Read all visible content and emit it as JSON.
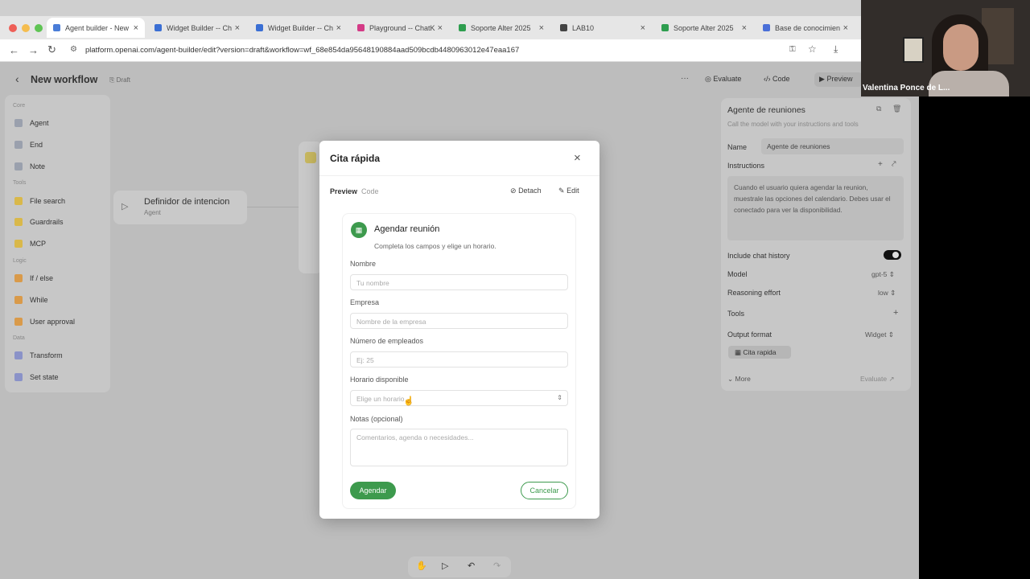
{
  "browser": {
    "tabs": [
      {
        "label": "Agent builder - New",
        "color": "#4a7dd8"
      },
      {
        "label": "Widget Builder -- Ch",
        "color": "#3b6fd4"
      },
      {
        "label": "Widget Builder -- Ch",
        "color": "#3b6fd4"
      },
      {
        "label": "Playground -- ChatK",
        "color": "#d43b86"
      },
      {
        "label": "Soporte Alter 2025",
        "color": "#2e9e4f"
      },
      {
        "label": "LAB10",
        "color": "#444444"
      },
      {
        "label": "Soporte Alter 2025",
        "color": "#2e9e4f"
      },
      {
        "label": "Base de conocimien",
        "color": "#4a6fd8"
      }
    ],
    "url": "platform.openai.com/agent-builder/edit?version=draft&workflow=wf_68e854da95648190884aad509bcdb4480963012e47eaa167"
  },
  "header": {
    "back_glyph": "‹",
    "title": "New workflow",
    "draft": "Draft",
    "more": "···",
    "evaluate": "Evaluate",
    "code": "Code",
    "preview": "Preview"
  },
  "sidebar": {
    "sections": {
      "core": "Core",
      "tools": "Tools",
      "logic": "Logic",
      "data": "Data"
    },
    "items": [
      {
        "label": "Agent",
        "color": "#9aa0ad"
      },
      {
        "label": "End",
        "color": "#9aa0ad"
      },
      {
        "label": "Note",
        "color": "#9aa0ad"
      },
      {
        "label": "File search",
        "color": "#d9b84a"
      },
      {
        "label": "Guardrails",
        "color": "#d9b84a"
      },
      {
        "label": "MCP",
        "color": "#d9b84a"
      },
      {
        "label": "If / else",
        "color": "#d99a4a"
      },
      {
        "label": "While",
        "color": "#d99a4a"
      },
      {
        "label": "User approval",
        "color": "#d99a4a"
      },
      {
        "label": "Transform",
        "color": "#8a92c8"
      },
      {
        "label": "Set state",
        "color": "#8a92c8"
      }
    ]
  },
  "canvas": {
    "node_title": "Definidor de intencion",
    "node_sub": "Agent"
  },
  "inspector": {
    "title": "Agente de reuniones",
    "subtitle": "Call the model with your instructions and tools",
    "name_label": "Name",
    "name_value": "Agente de reuniones",
    "instructions_label": "Instructions",
    "instructions_text": "Cuando el usuario quiera agendar la reunion, muestrale las opciones del calendario. Debes usar el conectado para ver la disponibilidad.",
    "chat_history_label": "Include chat history",
    "chat_history_on": true,
    "model_label": "Model",
    "model_value": "gpt-5",
    "reasoning_label": "Reasoning effort",
    "reasoning_value": "low",
    "tools_label": "Tools",
    "tools_add": "+",
    "output_label": "Output format",
    "output_value": "Widget",
    "widget_chip": "Cita rapida",
    "more": "More",
    "evaluate": "Evaluate"
  },
  "modal": {
    "title": "Cita rápida",
    "close": "×",
    "tab_preview": "Preview",
    "tab_code": "Code",
    "detach": "Detach",
    "edit": "Edit",
    "form": {
      "heading": "Agendar reunión",
      "subheading": "Completa los campos y elige un horario.",
      "nombre_label": "Nombre",
      "nombre_placeholder": "Tu nombre",
      "empresa_label": "Empresa",
      "empresa_placeholder": "Nombre de la empresa",
      "empleados_label": "Número de empleados",
      "empleados_placeholder": "Ej: 25",
      "horario_label": "Horario disponible",
      "horario_placeholder": "Elige un horario",
      "notas_label": "Notas (opcional)",
      "notas_placeholder": "Comentarios, agenda o necesidades...",
      "submit": "Agendar",
      "cancel": "Cancelar"
    }
  },
  "webcam": {
    "name": "Valentina Ponce de L..."
  }
}
